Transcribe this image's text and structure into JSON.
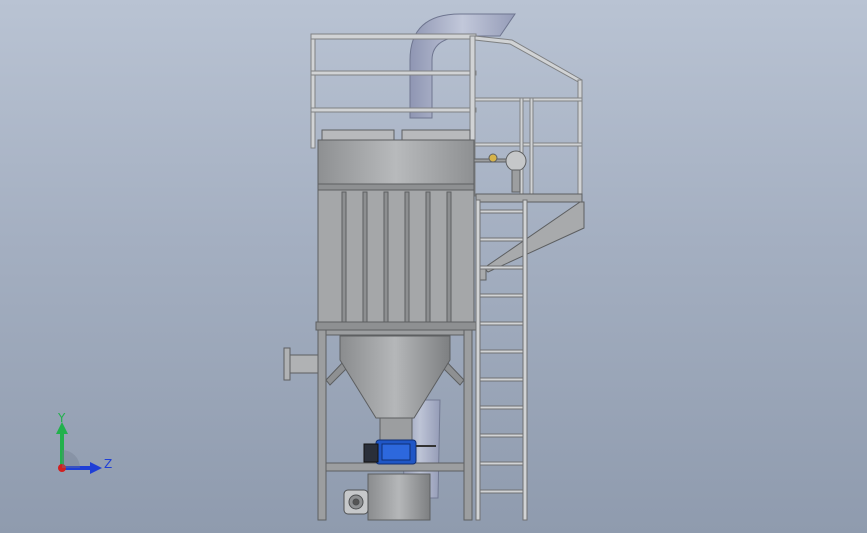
{
  "viewport": {
    "background_top": "#b9c3d3",
    "background_bottom": "#8f9bae",
    "model": {
      "steel_color": "#a7a9ab",
      "steel_dark": "#6f7072",
      "rail_color": "#cfd1d3",
      "motor_color": "#1f56c6",
      "duct_color": "#a8b0c9"
    }
  },
  "triad": {
    "y_label": "Y",
    "z_label": "Z",
    "y_color": "#22b14c",
    "z_color": "#1f3fd6",
    "x_color": "#d21f1f"
  }
}
